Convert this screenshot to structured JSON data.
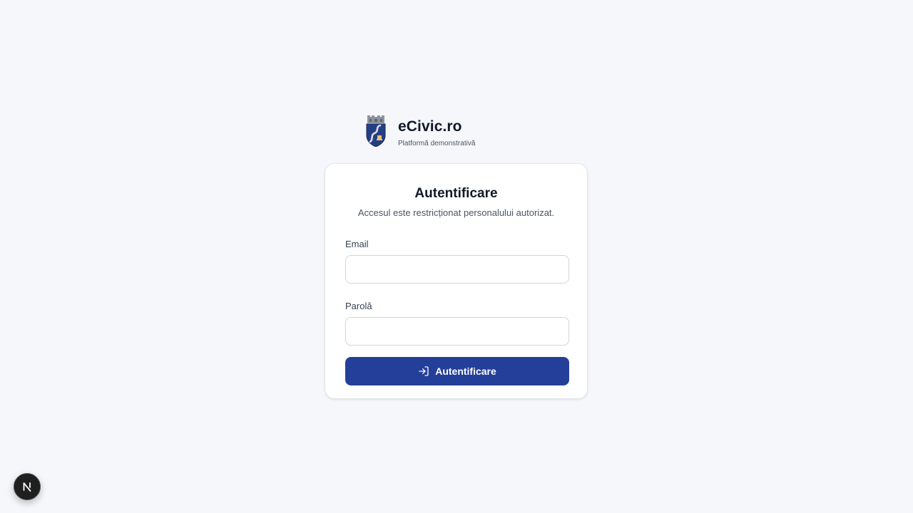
{
  "brand": {
    "name": "eCivic.ro",
    "tagline": "Platformă demonstrativă",
    "logo_icon": "coat-of-arms-icon"
  },
  "login": {
    "title": "Autentificare",
    "subtitle": "Accesul este restricționat personalului autorizat.",
    "email_label": "Email",
    "email_value": "",
    "password_label": "Parolă",
    "password_value": "",
    "submit_label": "Autentificare",
    "submit_icon": "log-in-icon"
  },
  "devtools": {
    "icon": "nextjs-logo-icon"
  },
  "colors": {
    "page_background": "#f6f7fb",
    "primary": "#233f99",
    "card_border": "#e5e7eb",
    "text_primary": "#111827",
    "text_secondary": "#4b5563"
  }
}
